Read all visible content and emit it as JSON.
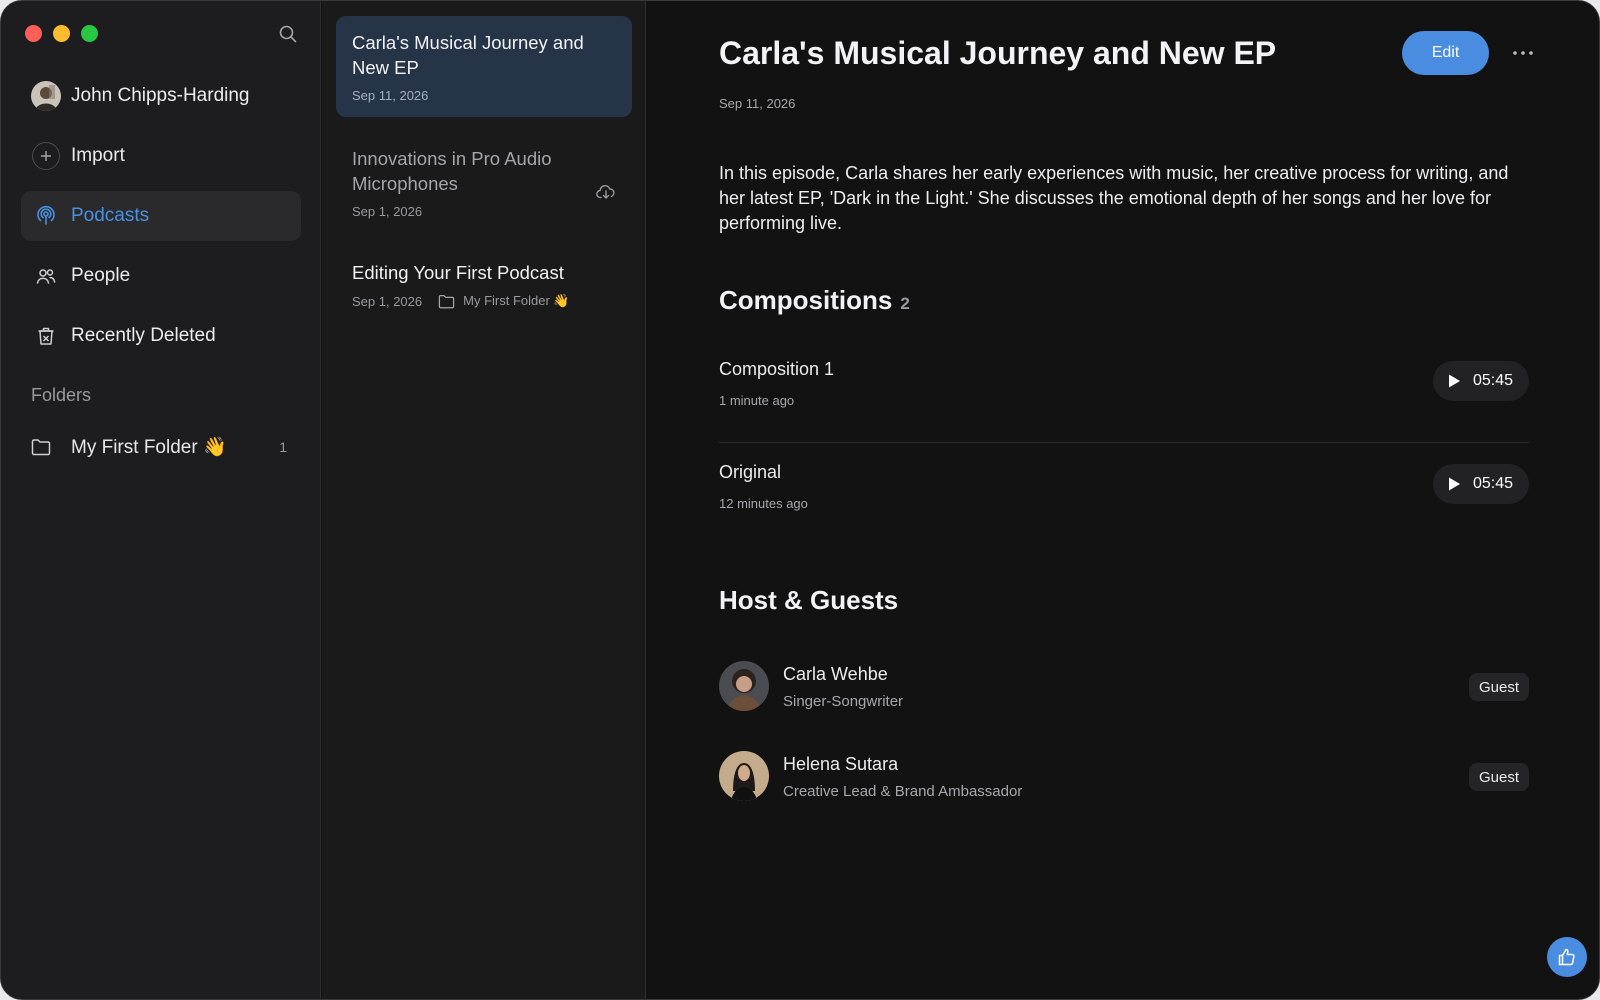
{
  "sidebar": {
    "user_name": "John Chipps-Harding",
    "import_label": "Import",
    "nav": [
      {
        "label": "Podcasts",
        "icon": "podcast-icon",
        "active": true
      },
      {
        "label": "People",
        "icon": "people-icon"
      },
      {
        "label": "Recently Deleted",
        "icon": "trash-icon"
      }
    ],
    "folders_heading": "Folders",
    "folder": {
      "label": "My First Folder 👋",
      "count": "1"
    }
  },
  "episodes": [
    {
      "title": "Carla's Musical Journey and New EP",
      "date": "Sep 11, 2026",
      "active": true
    },
    {
      "title": "Innovations in Pro Audio Microphones",
      "date": "Sep 1, 2026",
      "cloud": true
    },
    {
      "title": "Editing Your First Podcast",
      "date": "Sep 1, 2026",
      "folder": "My First Folder 👋"
    }
  ],
  "detail": {
    "title": "Carla's Musical Journey and New EP",
    "date": "Sep 11, 2026",
    "edit_label": "Edit",
    "description": "In this episode, Carla shares her early experiences with music, her creative process for writing, and her latest EP, 'Dark in the Light.' She discusses the emotional depth of her songs and her love for performing live.",
    "compositions_heading": "Compositions",
    "compositions_count": "2",
    "compositions": [
      {
        "name": "Composition 1",
        "time": "1 minute ago",
        "duration": "05:45"
      },
      {
        "name": "Original",
        "time": "12 minutes ago",
        "duration": "05:45"
      }
    ],
    "guests_heading": "Host & Guests",
    "guests": [
      {
        "name": "Carla Wehbe",
        "role": "Singer-Songwriter",
        "badge": "Guest"
      },
      {
        "name": "Helena Sutara",
        "role": "Creative Lead & Brand Ambassador",
        "badge": "Guest"
      }
    ]
  },
  "colors": {
    "accent": "#4a8de0",
    "sidebar_bg": "#1d1d1f",
    "active_episode_bg": "#263448"
  }
}
